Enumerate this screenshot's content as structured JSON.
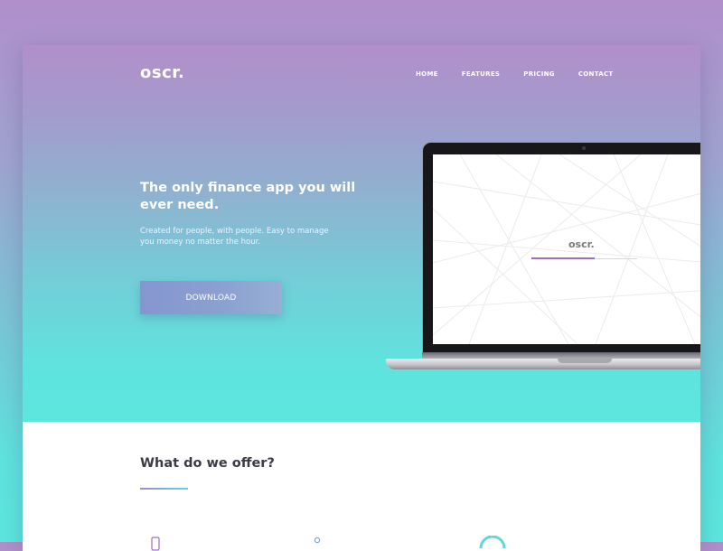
{
  "brand": {
    "logo_text": "oscr."
  },
  "nav": {
    "items": [
      "HOME",
      "FEATURES",
      "PRICING",
      "CONTACT"
    ]
  },
  "hero": {
    "headline": "The only finance app you will ever need.",
    "subtext": "Created for people, with people. Easy to manage you money no matter the hour.",
    "cta_label": "DOWNLOAD"
  },
  "device_screen": {
    "logo_text": "oscr."
  },
  "offer": {
    "title": "What do we offer?"
  },
  "colors": {
    "gradient_top": "#b08fcb",
    "gradient_bottom": "#5ce6de",
    "accent_purple": "#9c6fc7",
    "accent_teal": "#5fd8dc",
    "button": "#8596cf"
  },
  "icons": [
    "phone-icon",
    "user-icon",
    "chart-icon"
  ]
}
